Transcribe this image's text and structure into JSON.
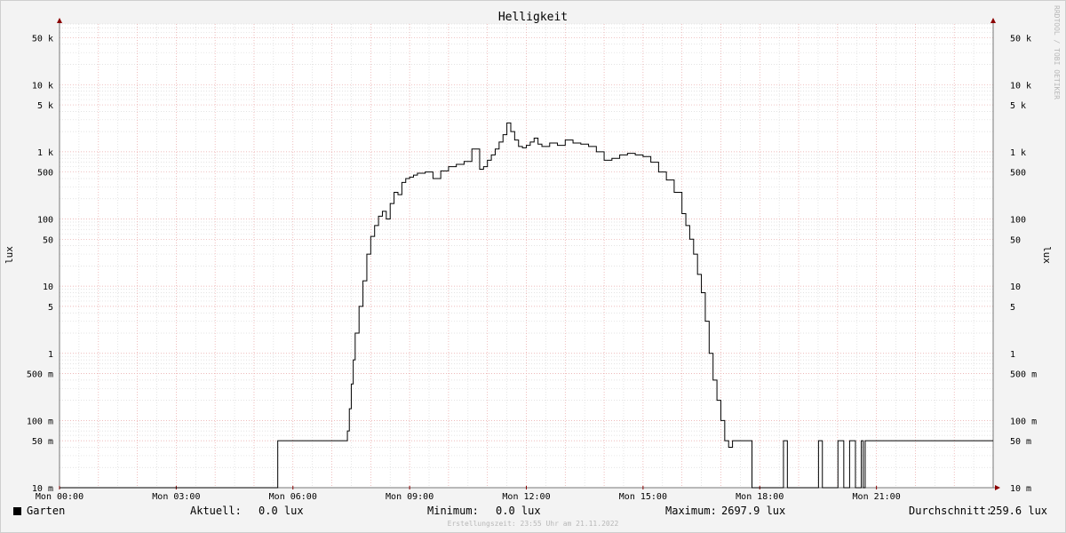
{
  "chart_data": {
    "type": "line",
    "title": "Helligkeit",
    "ylabel": "lux",
    "y_scale": "log",
    "ylim": [
      0.01,
      80000
    ],
    "xlim": [
      0,
      24
    ],
    "grid": true,
    "x_ticks": [
      {
        "hour": 0,
        "label": "Mon 00:00"
      },
      {
        "hour": 3,
        "label": "Mon 03:00"
      },
      {
        "hour": 6,
        "label": "Mon 06:00"
      },
      {
        "hour": 9,
        "label": "Mon 09:00"
      },
      {
        "hour": 12,
        "label": "Mon 12:00"
      },
      {
        "hour": 15,
        "label": "Mon 15:00"
      },
      {
        "hour": 18,
        "label": "Mon 18:00"
      },
      {
        "hour": 21,
        "label": "Mon 21:00"
      }
    ],
    "y_ticks": [
      {
        "value": 50000,
        "label": "50 k"
      },
      {
        "value": 10000,
        "label": "10 k"
      },
      {
        "value": 5000,
        "label": "5 k"
      },
      {
        "value": 1000,
        "label": "1 k"
      },
      {
        "value": 500,
        "label": "500"
      },
      {
        "value": 100,
        "label": "100"
      },
      {
        "value": 50,
        "label": "50"
      },
      {
        "value": 10,
        "label": "10"
      },
      {
        "value": 5,
        "label": "5"
      },
      {
        "value": 1,
        "label": "1"
      },
      {
        "value": 0.5,
        "label": "500 m"
      },
      {
        "value": 0.1,
        "label": "100 m"
      },
      {
        "value": 0.05,
        "label": "50 m"
      },
      {
        "value": 0.01,
        "label": "10 m"
      }
    ],
    "watermark": "RRDTOOL / TOBI OETIKER",
    "series": [
      {
        "name": "Garten",
        "color": "#000000",
        "x": [
          0,
          5.6,
          5.61,
          7.35,
          7.4,
          7.45,
          7.5,
          7.55,
          7.6,
          7.7,
          7.8,
          7.9,
          8.0,
          8.1,
          8.2,
          8.3,
          8.4,
          8.5,
          8.6,
          8.7,
          8.8,
          8.9,
          9.0,
          9.1,
          9.2,
          9.4,
          9.6,
          9.8,
          10.0,
          10.2,
          10.4,
          10.6,
          10.8,
          10.9,
          11.0,
          11.1,
          11.2,
          11.3,
          11.4,
          11.5,
          11.6,
          11.7,
          11.8,
          11.9,
          12.0,
          12.1,
          12.2,
          12.3,
          12.4,
          12.6,
          12.8,
          13.0,
          13.2,
          13.4,
          13.6,
          13.8,
          14.0,
          14.2,
          14.4,
          14.6,
          14.8,
          15.0,
          15.2,
          15.4,
          15.6,
          15.8,
          16.0,
          16.1,
          16.2,
          16.3,
          16.4,
          16.5,
          16.6,
          16.7,
          16.8,
          16.9,
          17.0,
          17.1,
          17.2,
          17.3,
          17.4,
          17.5,
          17.6,
          17.65,
          17.8,
          17.81,
          18.6,
          18.61,
          18.7,
          18.71,
          19.5,
          19.51,
          19.6,
          19.61,
          20.0,
          20.01,
          20.15,
          20.16,
          20.3,
          20.31,
          20.45,
          20.46,
          20.6,
          20.61,
          20.65,
          20.66,
          20.7,
          20.71,
          24
        ],
        "values": [
          0.01,
          0.01,
          0.05,
          0.05,
          0.07,
          0.15,
          0.35,
          0.8,
          2,
          5,
          12,
          30,
          55,
          80,
          110,
          130,
          100,
          170,
          250,
          230,
          350,
          400,
          420,
          450,
          480,
          500,
          400,
          520,
          600,
          650,
          720,
          1100,
          550,
          600,
          750,
          900,
          1100,
          1400,
          1800,
          2697.9,
          2000,
          1500,
          1200,
          1150,
          1250,
          1400,
          1600,
          1300,
          1200,
          1350,
          1250,
          1500,
          1350,
          1300,
          1200,
          1000,
          750,
          800,
          900,
          950,
          900,
          850,
          700,
          500,
          380,
          250,
          120,
          80,
          50,
          30,
          15,
          8,
          3,
          1,
          0.4,
          0.2,
          0.1,
          0.05,
          0.04,
          0.05,
          0.05,
          0.05,
          0.05,
          0.05,
          0.01,
          0.01,
          0.01,
          0.05,
          0.05,
          0.01,
          0.01,
          0.05,
          0.05,
          0.01,
          0.01,
          0.05,
          0.05,
          0.01,
          0.01,
          0.05,
          0.05,
          0.01,
          0.01,
          0.05,
          0.05,
          0.01,
          0.01,
          0.05,
          0.05
        ]
      }
    ]
  },
  "legend": {
    "series_name": "Garten",
    "current_label": "Aktuell:",
    "current_value": "0.0 lux",
    "min_label": "Minimum:",
    "min_value": "0.0 lux",
    "max_label": "Maximum:",
    "max_value": "2697.9 lux",
    "avg_label": "Durchschnitt:",
    "avg_value": "259.6 lux"
  },
  "footer": {
    "text": "Erstellungszeit: 23:55 Uhr am 21.11.2022"
  },
  "colors": {
    "background": "#f3f3f3",
    "plot_background": "#ffffff",
    "major_grid": "#e8a3a3",
    "minor_grid": "#dadada",
    "axis": "#777777",
    "arrow": "#8b0000"
  }
}
